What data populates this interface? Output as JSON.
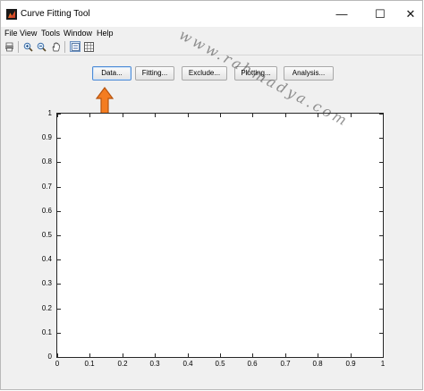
{
  "window": {
    "title": "Curve Fitting Tool",
    "controls": {
      "minimize": "—",
      "maximize": "☐",
      "close": "✕"
    }
  },
  "menubar": {
    "items": [
      {
        "label": "File"
      },
      {
        "label": "View"
      },
      {
        "label": "Tools"
      },
      {
        "label": "Window"
      },
      {
        "label": "Help"
      }
    ]
  },
  "toolbar": {
    "icons": [
      "print-icon",
      "zoom-in-icon",
      "zoom-out-icon",
      "pan-hand-icon",
      "legend-toggle-icon",
      "grid-toggle-icon"
    ]
  },
  "actions": {
    "data": "Data...",
    "fitting": "Fitting...",
    "exclude": "Exclude...",
    "plotting": "Plotting...",
    "analysis": "Analysis..."
  },
  "watermark": "www.rahmadya.com",
  "colors": {
    "arrow_fill": "#f47c20",
    "arrow_stroke": "#b55410",
    "focus_border": "#4f8cd6",
    "axes_line": "#262626"
  },
  "chart_data": {
    "type": "line",
    "title": "",
    "xlabel": "",
    "ylabel": "",
    "xlim": [
      0,
      1
    ],
    "ylim": [
      0,
      1
    ],
    "x_ticks": [
      "0",
      "0.1",
      "0.2",
      "0.3",
      "0.4",
      "0.5",
      "0.6",
      "0.7",
      "0.8",
      "0.9",
      "1"
    ],
    "y_ticks": [
      "0",
      "0.1",
      "0.2",
      "0.3",
      "0.4",
      "0.5",
      "0.6",
      "0.7",
      "0.8",
      "0.9",
      "1"
    ],
    "series": [],
    "grid": false
  }
}
